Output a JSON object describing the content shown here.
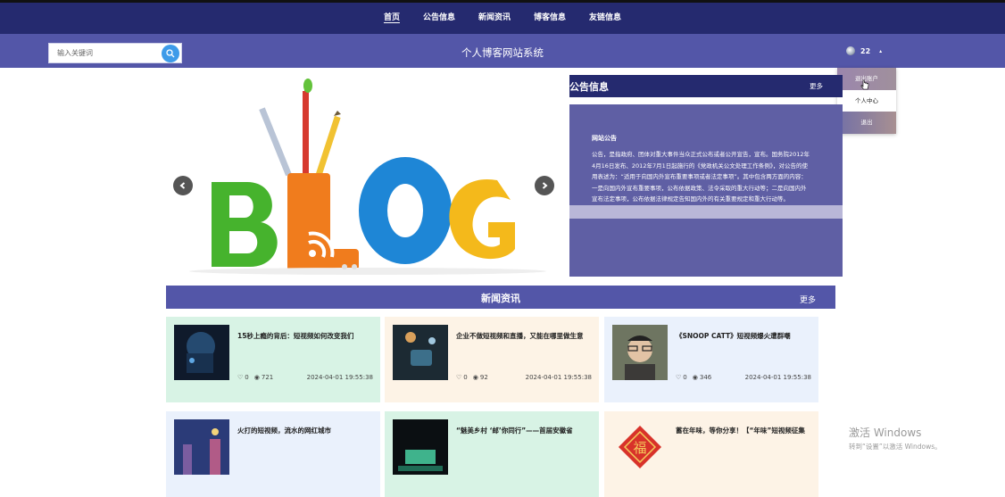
{
  "nav": {
    "items": [
      {
        "label": "首页",
        "active": true
      },
      {
        "label": "公告信息",
        "active": false
      },
      {
        "label": "新闻资讯",
        "active": false
      },
      {
        "label": "博客信息",
        "active": false
      },
      {
        "label": "友链信息",
        "active": false
      }
    ]
  },
  "header": {
    "site_title": "个人博客网站系统",
    "search_placeholder": "输入关键词",
    "search_icon": "search-icon",
    "user_name": "22",
    "user_caret": "▴"
  },
  "user_menu": {
    "items": [
      "退出账户",
      "个人中心",
      "退出"
    ]
  },
  "carousel": {
    "image_label": "BLOG",
    "prev_icon": "chevron-left-icon",
    "next_icon": "chevron-right-icon",
    "slide_count": 2,
    "active_slide": 0
  },
  "notice": {
    "title": "公告信息",
    "more": "更多",
    "item_title": "网站公告",
    "item_text": "公告，是指政府、团体对重大事件当众正式公布或者公开宣告，宣布。国务院2012年4月16日发布、2012年7月1日起施行的《党政机关公文处理工作条例》，对公告的使用表述为：“适用于向国内外宣布重要事项或者法定事项”。其中包含两方面的内容：一是向国内外宣布重要事项，公布依据政策、法令采取的重大行动等；二是向国内外宣布法定事项，公布依据法律规定告知国内外的有关重要规定和重大行动等。"
  },
  "news": {
    "title": "新闻资讯",
    "more": "更多",
    "cards": [
      {
        "title": "15秒上瘾的背后：短视频如何改变我们",
        "likes": "0",
        "views": "721",
        "date": "2024-04-01 19:55:38",
        "bg": "#d8f3e5"
      },
      {
        "title": "企业不做短视频和直播，又能在哪里做生意",
        "likes": "0",
        "views": "92",
        "date": "2024-04-01 19:55:38",
        "bg": "#fdf3e6"
      },
      {
        "title": "《SNOOP CATT》短视频爆火遭群嘲",
        "likes": "0",
        "views": "346",
        "date": "2024-04-01 19:55:38",
        "bg": "#eaf1fc"
      },
      {
        "title": "火打的短视频，流水的网红城市",
        "likes": "",
        "views": "",
        "date": "",
        "bg": "#eaf1fc"
      },
      {
        "title": "“魅美乡村 ‘邮’你同行”——首届安徽省",
        "likes": "",
        "views": "",
        "date": "",
        "bg": "#d8f3e5"
      },
      {
        "title": "蓄在年味，等你分享！【“年味”短视频征集",
        "likes": "",
        "views": "",
        "date": "",
        "bg": "#fdf3e6"
      }
    ]
  },
  "watermark": {
    "line1": "激活 Windows",
    "line2": "转到“设置”以激活 Windows。"
  }
}
